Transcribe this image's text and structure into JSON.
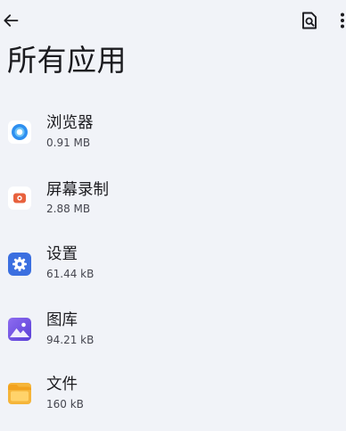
{
  "header": {
    "title": "所有应用",
    "back_icon": "arrow-back-icon",
    "search_icon": "search-document-icon",
    "more_icon": "more-vert-icon"
  },
  "apps": [
    {
      "name": "浏览器",
      "size": "0.91 MB",
      "icon": "browser-icon",
      "color": "#2e8ff0"
    },
    {
      "name": "屏幕录制",
      "size": "2.88 MB",
      "icon": "screen-recorder-icon",
      "color": "#e8613d"
    },
    {
      "name": "设置",
      "size": "61.44 kB",
      "icon": "settings-icon",
      "color": "#3b6fe0"
    },
    {
      "name": "图库",
      "size": "94.21 kB",
      "icon": "gallery-icon",
      "color": "#7a55e8"
    },
    {
      "name": "文件",
      "size": "160 kB",
      "icon": "files-icon",
      "color": "#f5b53a"
    }
  ]
}
